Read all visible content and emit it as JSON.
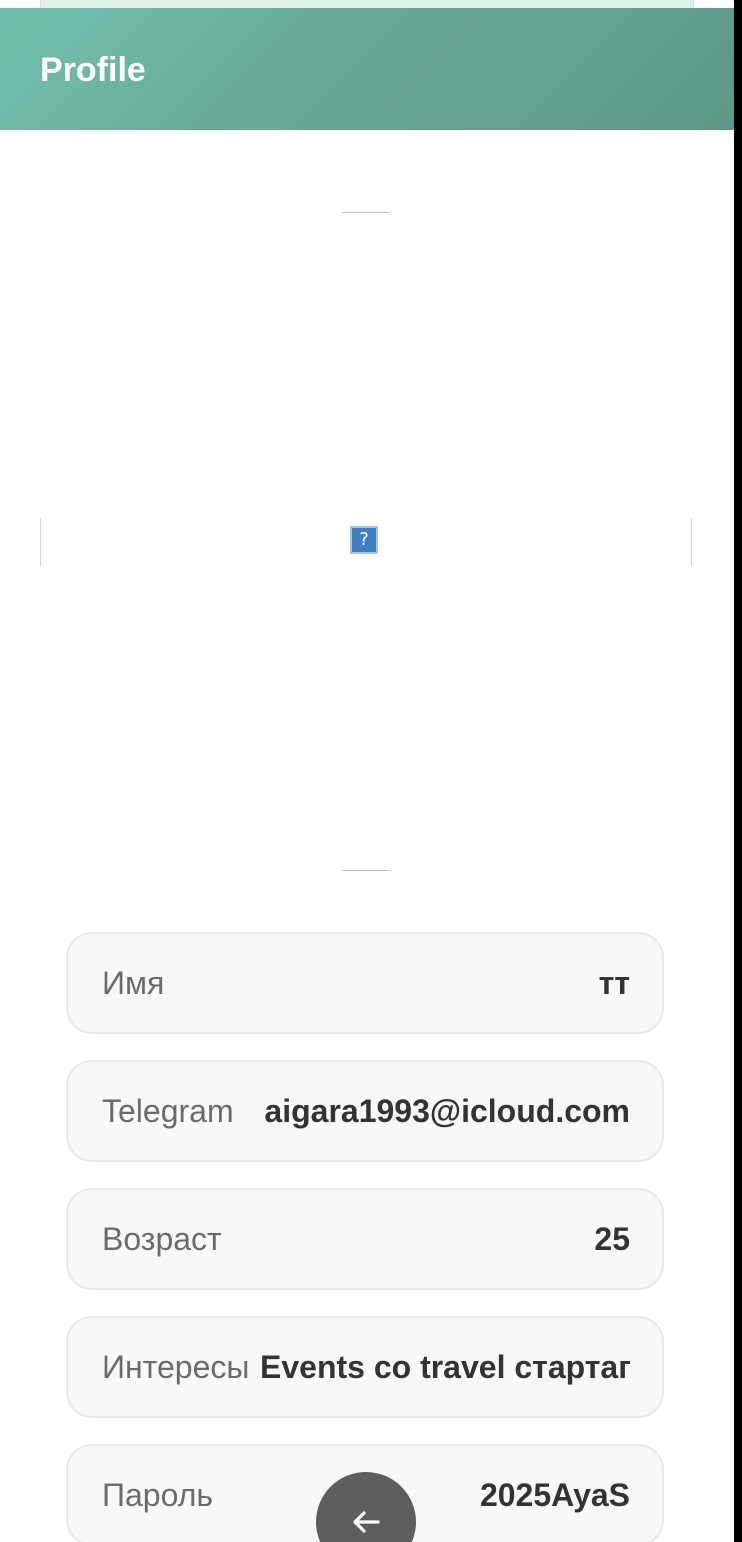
{
  "header": {
    "title": "Profile"
  },
  "avatar": {
    "broken_image_glyph": "?"
  },
  "profile_fields": [
    {
      "label": "Имя",
      "value": "тт"
    },
    {
      "label": "Telegram",
      "value": "aigara1993@icloud.com"
    },
    {
      "label": "Возраст",
      "value": "25"
    },
    {
      "label": "Интересы",
      "value": "Events co travel стартап"
    },
    {
      "label": "Пароль",
      "value": "2025AyaS"
    }
  ],
  "icons": {
    "back": "arrow-left-icon",
    "avatar_placeholder": "broken-image-icon"
  },
  "colors": {
    "header_gradient_start": "#74bfad",
    "header_gradient_end": "#5d9887",
    "field_background": "#f7f8fa",
    "back_button": "#5d5d5d"
  }
}
